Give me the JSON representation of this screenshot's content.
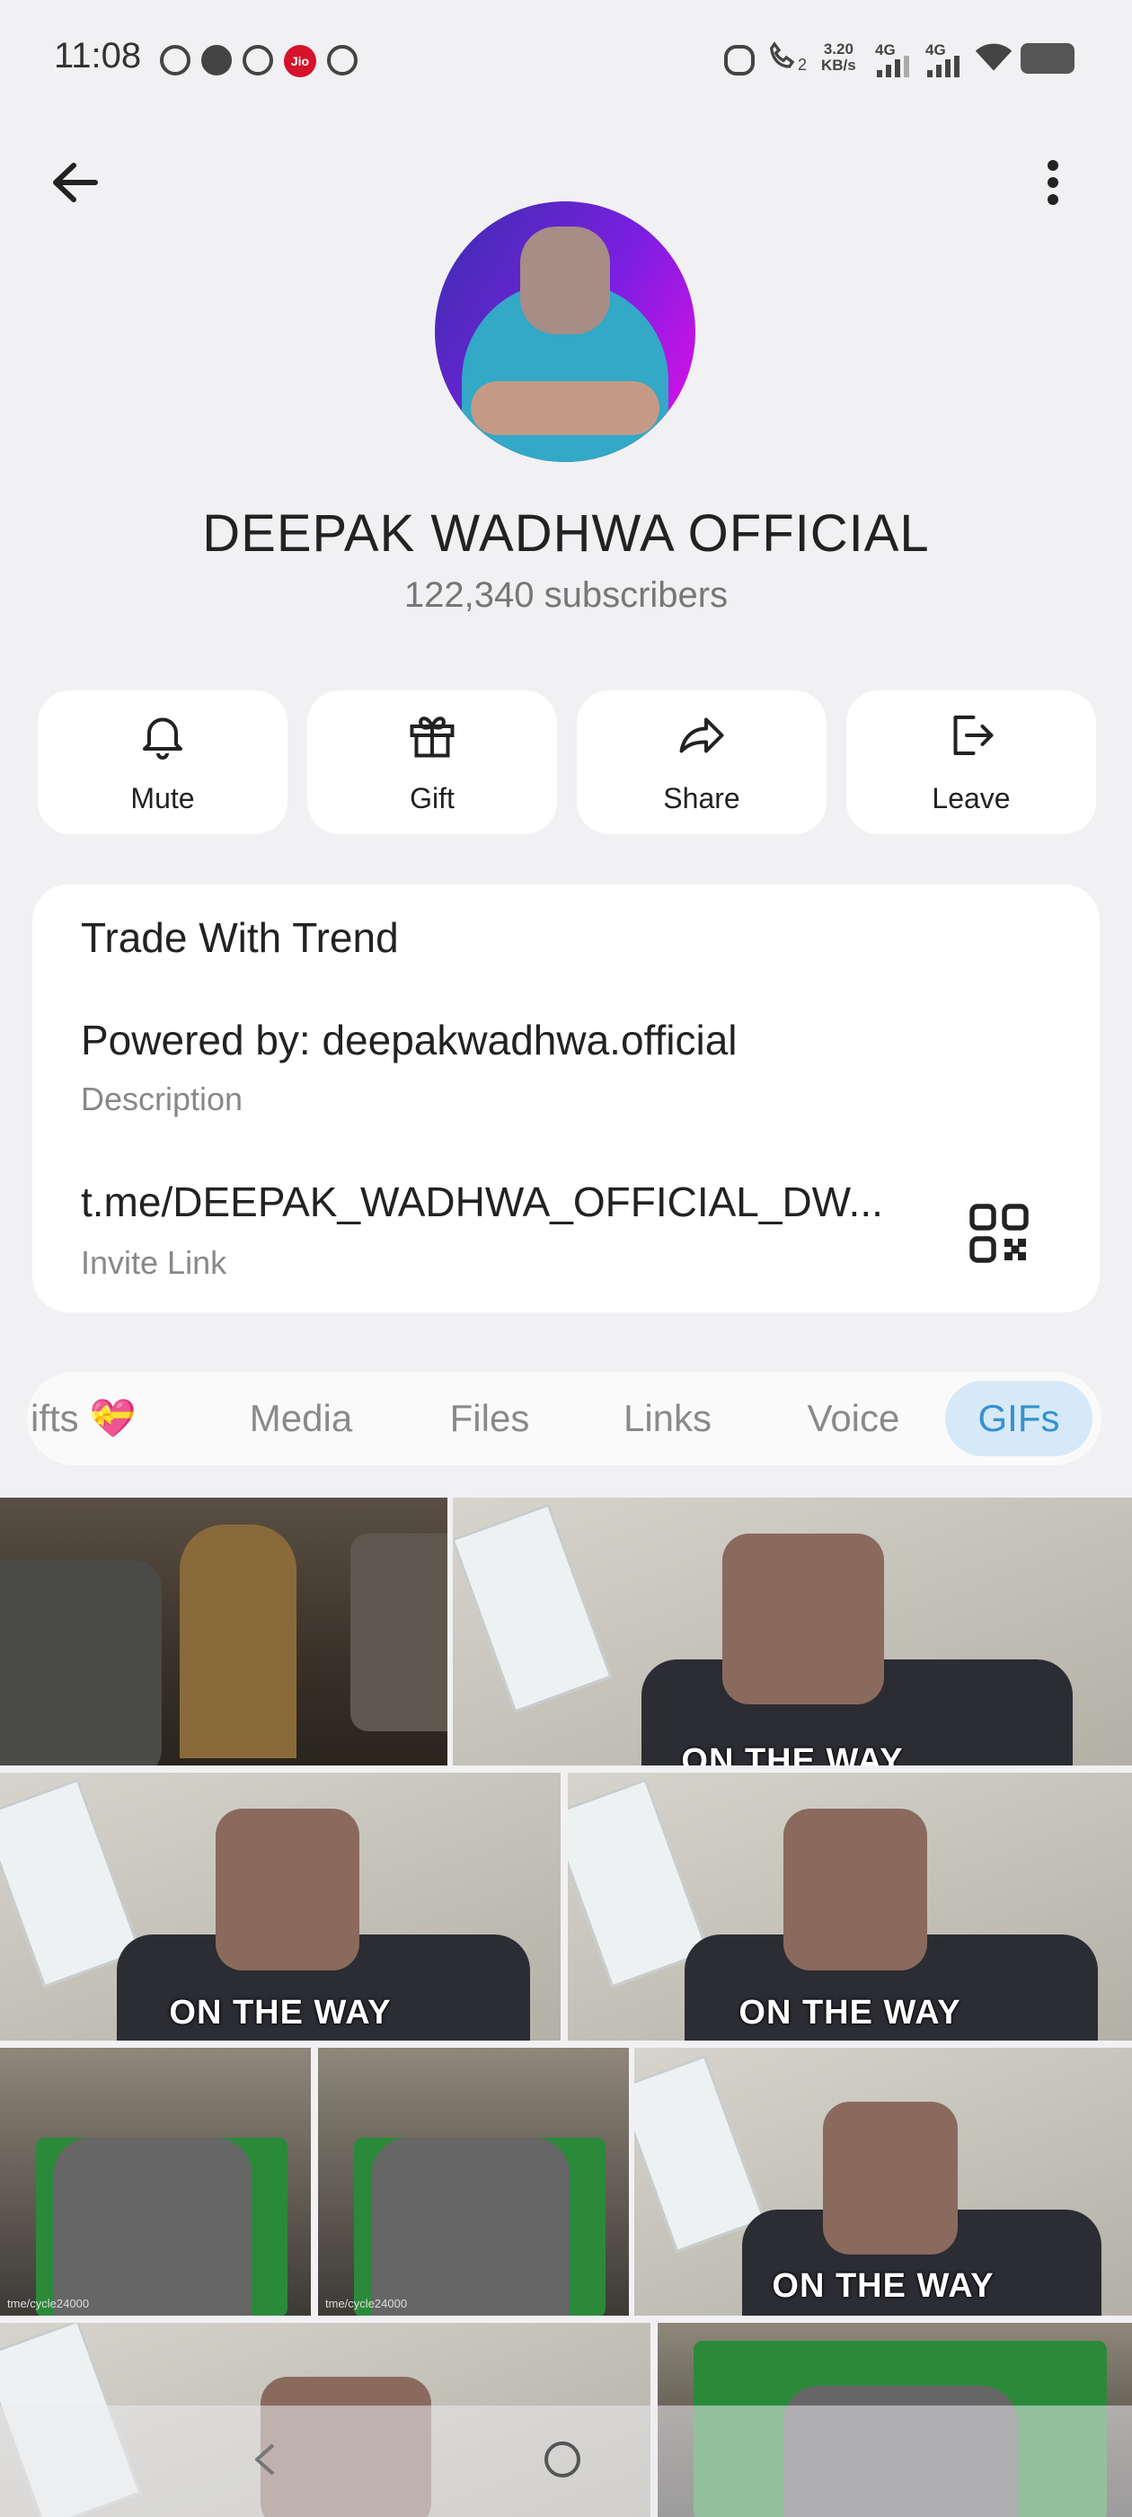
{
  "status_bar": {
    "time": "11:08",
    "jio_label": "Jio",
    "net_speed": "3.20\nKB/s",
    "signal_1": "4G",
    "signal_2": "4G",
    "call_sim": "2"
  },
  "header": {
    "back_icon": "arrow-left-icon",
    "more_icon": "more-vertical-icon"
  },
  "channel": {
    "name": "DEEPAK WADHWA OFFICIAL",
    "subscribers": "122,340 subscribers"
  },
  "actions": [
    {
      "label": "Mute",
      "icon": "bell-icon"
    },
    {
      "label": "Gift",
      "icon": "gift-icon"
    },
    {
      "label": "Share",
      "icon": "share-icon"
    },
    {
      "label": "Leave",
      "icon": "leave-icon"
    }
  ],
  "info": {
    "title": "Trade With Trend",
    "description": "Powered by: deepakwadhwa.official",
    "description_label": "Description",
    "invite_link": "t.me/DEEPAK_WADHWA_OFFICIAL_DW...",
    "invite_link_label": "Invite Link"
  },
  "tabs": [
    {
      "label": "ifts 💝",
      "active": false
    },
    {
      "label": "Media",
      "active": false
    },
    {
      "label": "Files",
      "active": false
    },
    {
      "label": "Links",
      "active": false
    },
    {
      "label": "Voice",
      "active": false
    },
    {
      "label": "GIFs",
      "active": true
    }
  ],
  "gifs": {
    "caption": "ON THE WAY",
    "watermark": "tme/cycle24000"
  },
  "colors": {
    "background": "#f1f1f4",
    "accent": "#3591cf",
    "active_tab_bg": "#d6e9f7"
  }
}
